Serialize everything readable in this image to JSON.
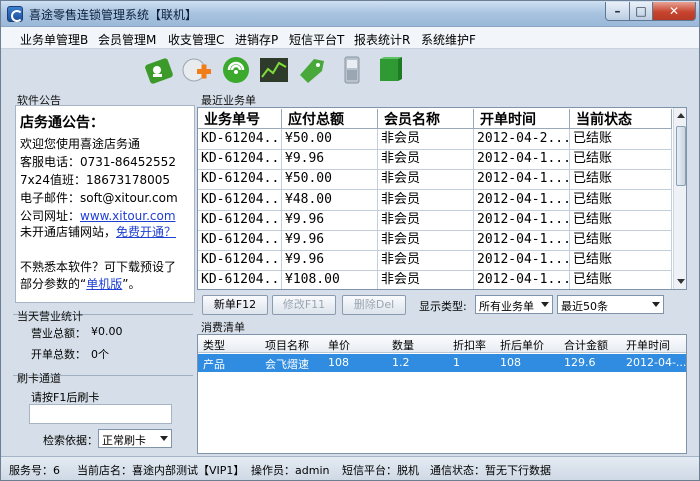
{
  "window": {
    "title": "喜途零售连锁管理系统【联机】",
    "controls": {
      "minimize": "–",
      "maximize": "□",
      "close": "✕"
    }
  },
  "menu": [
    "业务单管理B",
    "会员管理M",
    "收支管理C",
    "进销存P",
    "短信平台T",
    "报表统计R",
    "系统维护F"
  ],
  "toolbar": [
    {
      "icon": "member-card-icon",
      "color": "#3c9a2a"
    },
    {
      "icon": "add-item-icon",
      "color": "#f07c1a"
    },
    {
      "icon": "sms-icon",
      "color": "#3aa92c"
    },
    {
      "icon": "report-chart-icon",
      "color": "#2f3b2a"
    },
    {
      "icon": "tag-icon",
      "color": "#49a83a"
    },
    {
      "icon": "phone-icon",
      "color": "#b9c3cc"
    },
    {
      "icon": "book-icon",
      "color": "#2f9a34"
    }
  ],
  "notice": {
    "section_label": "软件公告",
    "title": "店务通公告：",
    "lines": [
      "欢迎您使用喜途店务通",
      "客服电话：0731-86452552",
      "7x24值班：18673178005",
      "电子邮件：soft@xitour.com"
    ],
    "website_prefix": "公司网址：",
    "website_link": "www.xitour.com",
    "shop_prefix": "未开通店铺网站，",
    "shop_link": "免费开通？",
    "unfamiliar_1": "不熟悉本软件？可下载预设了",
    "unfamiliar_2_prefix": "部分参数的“",
    "unfamiliar_2_link": "单机版",
    "unfamiliar_2_suffix": "”。"
  },
  "daily": {
    "section_label": "当天营业统计",
    "total_label": "营业总额：",
    "total_value": "¥0.00",
    "orders_label": "开单总数：",
    "orders_value": "0个"
  },
  "card": {
    "section_label": "刷卡通道",
    "prompt": "请按F1后刷卡",
    "input_value": "",
    "search_label": "检索依据：",
    "search_value": "正常刷卡"
  },
  "orders": {
    "section_label": "最近业务单",
    "columns": [
      "业务单号",
      "应付总额",
      "会员名称",
      "开单时间",
      "当前状态"
    ],
    "rows": [
      [
        "KD-61204...",
        "¥50.00",
        "非会员",
        "2012-04-2...",
        "已结账"
      ],
      [
        "KD-61204...",
        "¥9.96",
        "非会员",
        "2012-04-1...",
        "已结账"
      ],
      [
        "KD-61204...",
        "¥50.00",
        "非会员",
        "2012-04-1...",
        "已结账"
      ],
      [
        "KD-61204...",
        "¥48.00",
        "非会员",
        "2012-04-1...",
        "已结账"
      ],
      [
        "KD-61204...",
        "¥9.96",
        "非会员",
        "2012-04-1...",
        "已结账"
      ],
      [
        "KD-61204...",
        "¥9.96",
        "非会员",
        "2012-04-1...",
        "已结账"
      ],
      [
        "KD-61204...",
        "¥9.96",
        "非会员",
        "2012-04-1...",
        "已结账"
      ],
      [
        "KD-61204...",
        "¥108.00",
        "非会员",
        "2012-04-1...",
        "已结账"
      ]
    ],
    "buttons": {
      "new": "新单F12",
      "edit": "修改F11",
      "delete": "删除Del"
    },
    "filter_label": "显示类型:",
    "filter_value": "所有业务单",
    "limit_value": "最近50条"
  },
  "consume": {
    "section_label": "消费清单",
    "columns": [
      "类型",
      "项目名称",
      "单价",
      "数量",
      "折扣率",
      "折后单价",
      "合计金额",
      "开单时间"
    ],
    "rows": [
      [
        "产品",
        "会飞熠速",
        "108",
        "1.2",
        "1",
        "108",
        "129.6",
        "2012-04-..."
      ]
    ]
  },
  "status": {
    "service": "服务号：6",
    "shop": "当前店名：喜途内部测试【VIP1】",
    "operator": "操作员：admin",
    "sms": "短信平台：脱机",
    "connection": "通信状态：暂无下行数据"
  },
  "colors": {
    "selected_row": "#2f8ce0",
    "link": "#1f3fd3",
    "close_button": "#c7442f"
  }
}
